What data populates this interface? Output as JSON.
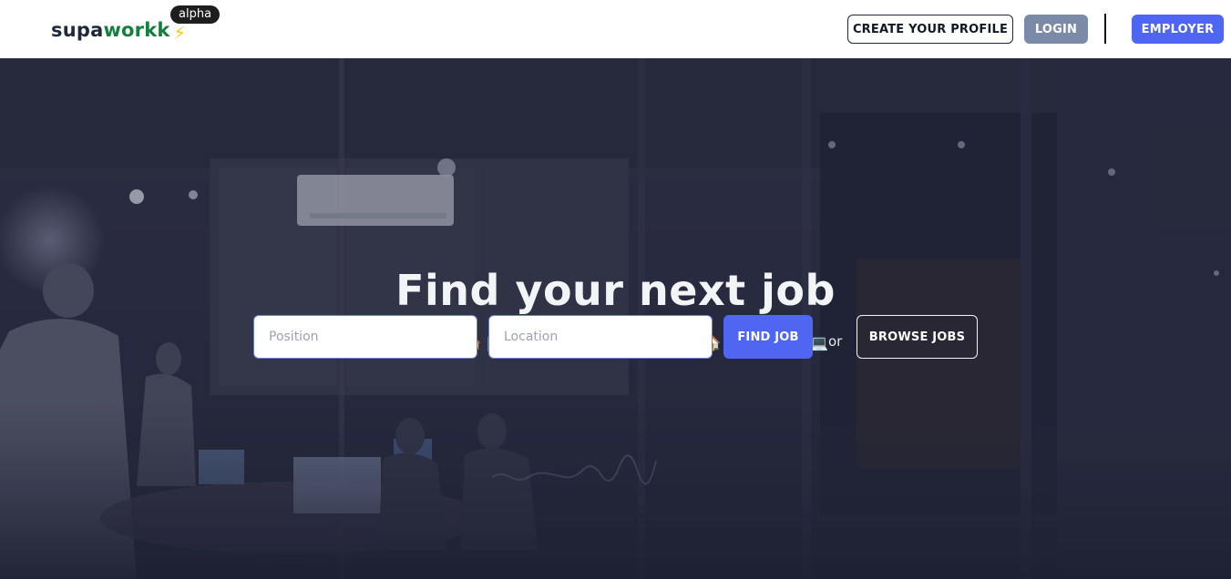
{
  "header": {
    "logo": {
      "part1": "supa",
      "part2": "workk",
      "badge": "alpha"
    },
    "create_profile_label": "CREATE YOUR PROFILE",
    "login_label": "LOGIN",
    "employer_label": "EMPLOYER"
  },
  "hero": {
    "title": "Find your next job",
    "tagline": "Remote 🏠 | Office 🏢 | Work from Home 🏠 | Freelance 💻",
    "search": {
      "position_placeholder": "Position",
      "location_placeholder": "Location",
      "find_label": "FIND JOB",
      "or_text": "or",
      "browse_label": "BROWSE JOBS"
    }
  },
  "colors": {
    "brand_green": "#15803d",
    "primary_blue": "#4f66f2",
    "login_gray": "#7b8aa7",
    "hero_bg": "#2e3045"
  }
}
